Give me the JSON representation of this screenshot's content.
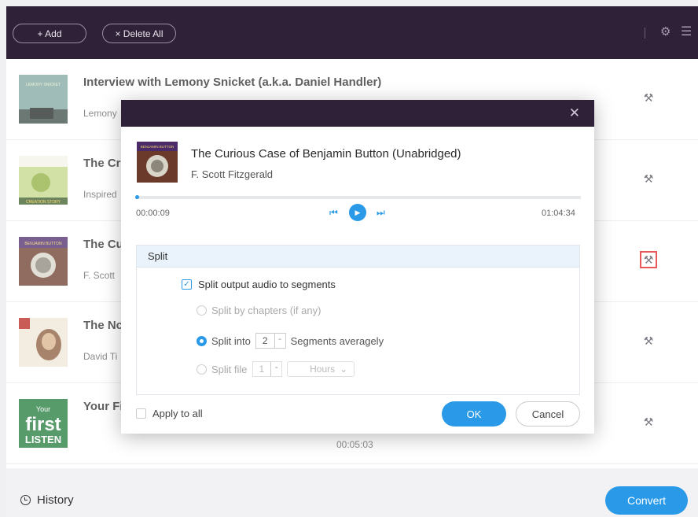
{
  "toolbar": {
    "add_label": "+ Add",
    "delete_all_label": "× Delete All",
    "settings_icon": "gear-icon",
    "menu_icon": "menu-icon"
  },
  "list": {
    "items": [
      {
        "title": "Interview with Lemony Snicket (a.k.a. Daniel Handler)",
        "subtitle": "Lemony",
        "duration": ""
      },
      {
        "title": "The Cr",
        "subtitle": "Inspired",
        "duration": ""
      },
      {
        "title": "The Cu",
        "subtitle": "F. Scott",
        "duration": ""
      },
      {
        "title": "The Nc",
        "subtitle": "David Ti",
        "duration": ""
      },
      {
        "title": "Your Fi",
        "subtitle": "",
        "duration": "00:05:03"
      }
    ],
    "cover_texts": {
      "item0": "LEMONY SNICKET",
      "item1": "CREATION STORY",
      "item2": "BENJAMIN BUTTON",
      "item4_line1": "Your",
      "item4_line2": "first",
      "item4_line3": "LISTEN"
    }
  },
  "bottom": {
    "history_label": "History",
    "convert_label": "Convert"
  },
  "dialog": {
    "close_glyph": "✕",
    "cover_text": "BENJAMIN BUTTON",
    "title": "The Curious Case of Benjamin Button (Unabridged)",
    "author": "F. Scott Fitzgerald",
    "time_current": "00:00:09",
    "time_total": "01:04:34",
    "progress_fraction": 0.002,
    "split": {
      "header": "Split",
      "main_checkbox_label": "Split output audio to segments",
      "main_checked": true,
      "by_chapters_label": "Split by chapters (if any)",
      "split_into_label": "Split into",
      "split_into_value": "2",
      "segments_label": "Segments averagely",
      "split_file_label": "Split file",
      "split_file_value": "1",
      "unit_value": "Hours"
    },
    "apply_all_label": "Apply to all",
    "ok_label": "OK",
    "cancel_label": "Cancel"
  },
  "colors": {
    "header_bg": "#2f2238",
    "accent": "#2a9ae8",
    "highlight_border": "#e02020"
  }
}
